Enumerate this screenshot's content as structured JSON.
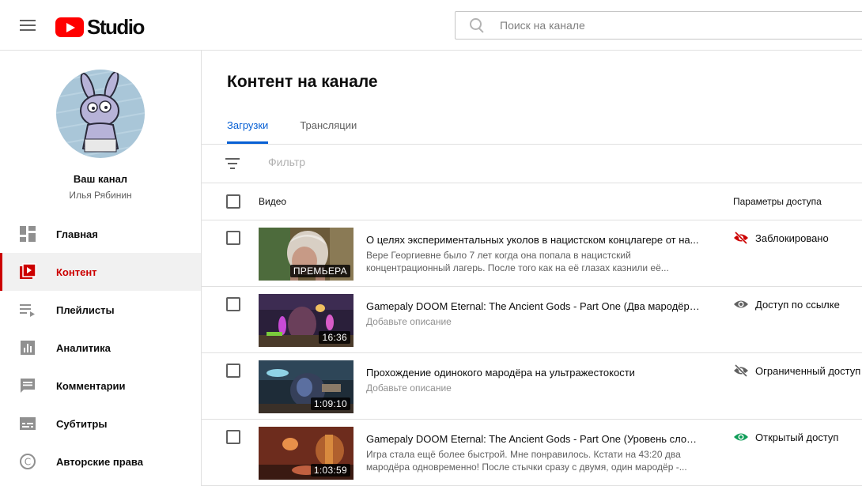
{
  "header": {
    "logo_text": "Studio",
    "search_placeholder": "Поиск на канале"
  },
  "channel": {
    "title": "Ваш канал",
    "name": "Илья Рябинин"
  },
  "sidebar": {
    "items": [
      {
        "label": "Главная",
        "icon": "dashboard-icon"
      },
      {
        "label": "Контент",
        "icon": "content-icon",
        "active": true
      },
      {
        "label": "Плейлисты",
        "icon": "playlist-icon"
      },
      {
        "label": "Аналитика",
        "icon": "analytics-icon"
      },
      {
        "label": "Комментарии",
        "icon": "comments-icon"
      },
      {
        "label": "Субтитры",
        "icon": "subtitles-icon"
      },
      {
        "label": "Авторские права",
        "icon": "copyright-icon"
      }
    ]
  },
  "main": {
    "title": "Контент на канале",
    "tabs": [
      {
        "label": "Загрузки",
        "active": true
      },
      {
        "label": "Трансляции"
      }
    ],
    "filter_placeholder": "Фильтр",
    "columns": {
      "video": "Видео",
      "access": "Параметры доступа"
    }
  },
  "videos": [
    {
      "title": "О целях экспериментальных уколов в нацистском концлагере от на...",
      "desc_line1": "Вере Георгиевне было 7 лет когда она попала в нацистский",
      "desc_line2": "концентрационный лагерь. После того как на её глазах казнили её...",
      "badge": "ПРЕМЬЕРА",
      "access": "Заблокировано",
      "access_icon": "eye-blocked-icon",
      "access_color": "#cc0000"
    },
    {
      "title": "Gamepaly DOOM Eternal: The Ancient Gods - Part One (Два мародёра на...",
      "desc_line1": "Добавьте описание",
      "badge": "16:36",
      "access": "Доступ по ссылке",
      "access_icon": "eye-icon",
      "access_color": "#606060"
    },
    {
      "title": "Прохождение одинокого мародёра на ультражестокости",
      "desc_line1": "Добавьте описание",
      "badge": "1:09:10",
      "access": "Ограниченный доступ",
      "access_icon": "eye-crossed-icon",
      "access_color": "#606060"
    },
    {
      "title": "Gamepaly DOOM Eternal: The Ancient Gods - Part One (Уровень сложно...",
      "desc_line1": "Игра стала ещё более быстрой. Мне понравилось. Кстати на 43:20 два",
      "desc_line2": "мародёра одновременно! После стычки сразу с двумя, один мародёр -...",
      "badge": "1:03:59",
      "access": "Открытый доступ",
      "access_icon": "eye-icon",
      "access_color": "#0f9d58"
    }
  ]
}
